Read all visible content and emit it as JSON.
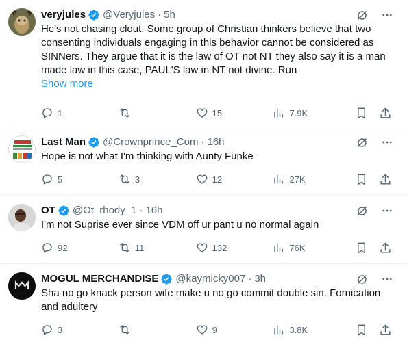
{
  "tweets": [
    {
      "name": "veryjules",
      "handle": "@Veryjules",
      "time": "5h",
      "text": "He's not chasing clout. Some group of Christian thinkers believe that two consenting individuals engaging in this behavior cannot be considered as SINNers. They argue that it is the law of OT not NT they also say it is a man made law in this case, PAUL'S law in NT not divine. Run",
      "show_more": "Show more",
      "replies": "1",
      "retweets": "",
      "likes": "15",
      "views": "7.9K"
    },
    {
      "name": "Last Man",
      "handle": "@Crownprince_Com",
      "time": "16h",
      "text": "Hope is not what I'm thinking with Aunty Funke",
      "replies": "5",
      "retweets": "3",
      "likes": "12",
      "views": "27K"
    },
    {
      "name": "OT",
      "handle": "@Ot_rhody_1",
      "time": "16h",
      "text": "I'm not Suprise ever since VDM off ur pant u no normal again",
      "replies": "92",
      "retweets": "11",
      "likes": "132",
      "views": "76K"
    },
    {
      "name": "MOGUL MERCHANDISE",
      "handle": "@kaymicky007",
      "time": "3h",
      "text": "Sha no go knack person wife make u no go commit double sin. Fornication and adultery",
      "replies": "3",
      "retweets": "",
      "likes": "9",
      "views": "3.8K"
    }
  ],
  "colors": {
    "verified": "#1d9bf0",
    "link": "#1d9bf0",
    "muted": "#536471"
  }
}
